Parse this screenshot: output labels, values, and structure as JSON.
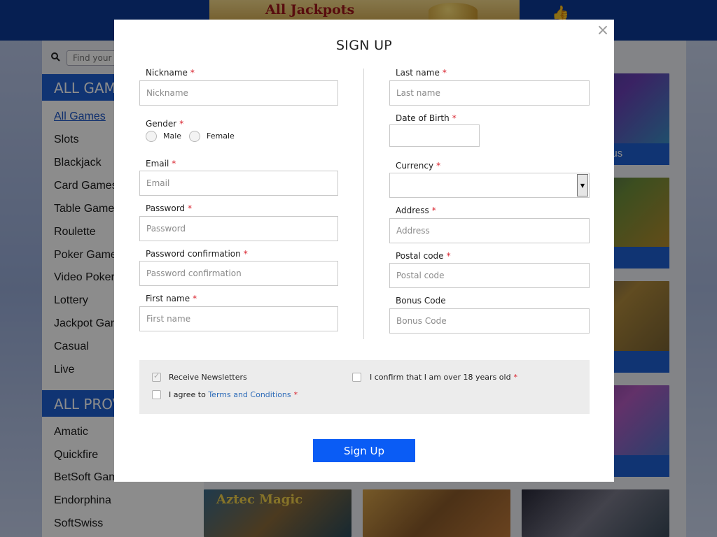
{
  "background": {
    "banner_text": "All Jackpots",
    "search_placeholder": "Find your",
    "sidebar_games_head": "ALL GAM",
    "sidebar_games": [
      "All Games",
      "Slots",
      "Blackjack",
      "Card Games",
      "Table Game",
      "Roulette",
      "Poker Game",
      "Video Poker",
      "Lottery",
      "Jackpot Gam",
      "Casual",
      "Live"
    ],
    "sidebar_providers_head": "ALL PROV",
    "sidebar_providers": [
      "Amatic",
      "Quickfire",
      "BetSoft Gam",
      "Endorphina",
      "SoftSwiss"
    ],
    "tile_caption": "nus",
    "tile_aztec_text": "Aztec Magic"
  },
  "modal": {
    "title": "SIGN UP",
    "close_glyph": "×",
    "required_mark": "*",
    "left": {
      "nickname": {
        "label": "Nickname",
        "placeholder": "Nickname"
      },
      "gender": {
        "label": "Gender",
        "options": [
          "Male",
          "Female"
        ]
      },
      "email": {
        "label": "Email",
        "placeholder": "Email"
      },
      "password": {
        "label": "Password",
        "placeholder": "Password"
      },
      "password_confirmation": {
        "label": "Password confirmation",
        "placeholder": "Password confirmation"
      },
      "first_name": {
        "label": "First name",
        "placeholder": "First name"
      }
    },
    "right": {
      "last_name": {
        "label": "Last name",
        "placeholder": "Last name"
      },
      "date_of_birth": {
        "label": "Date of Birth",
        "value": ""
      },
      "currency": {
        "label": "Currency",
        "value": ""
      },
      "address": {
        "label": "Address",
        "placeholder": "Address"
      },
      "postal_code": {
        "label": "Postal code",
        "placeholder": "Postal code"
      },
      "bonus_code": {
        "label": "Bonus Code",
        "placeholder": "Bonus Code"
      }
    },
    "checks": {
      "newsletters": {
        "label": "Receive Newsletters",
        "checked": true
      },
      "terms_prefix": "I agree to ",
      "terms_link": "Terms and Conditions",
      "age": "I confirm that I am over 18 years old"
    },
    "submit_label": "Sign Up"
  }
}
